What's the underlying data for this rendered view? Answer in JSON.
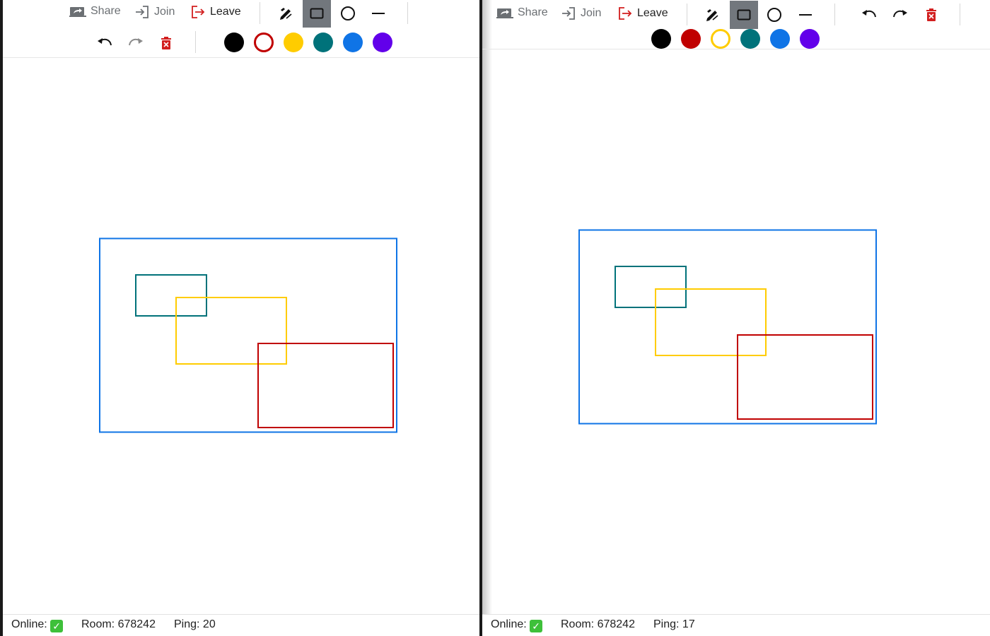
{
  "left": {
    "toolbar": {
      "share_label": "Share",
      "join_label": "Join",
      "leave_label": "Leave",
      "active_tool": "rectangle"
    },
    "palette": [
      {
        "name": "black",
        "color": "#000000",
        "selected": false
      },
      {
        "name": "red",
        "color": "#c00000",
        "selected": true
      },
      {
        "name": "yellow",
        "color": "#ffcc00",
        "selected": false
      },
      {
        "name": "teal",
        "color": "#00727a",
        "selected": false
      },
      {
        "name": "blue",
        "color": "#0f74e6",
        "selected": false
      },
      {
        "name": "purple",
        "color": "#6200ea",
        "selected": false
      }
    ],
    "status": {
      "online_label": "Online:",
      "room_label": "Room: 678242",
      "ping_label": "Ping: 20"
    }
  },
  "right": {
    "toolbar": {
      "share_label": "Share",
      "join_label": "Join",
      "leave_label": "Leave",
      "active_tool": "rectangle"
    },
    "palette": [
      {
        "name": "black",
        "color": "#000000",
        "selected": false
      },
      {
        "name": "red",
        "color": "#c00000",
        "selected": false
      },
      {
        "name": "yellow",
        "color": "#ffcc00",
        "selected": true
      },
      {
        "name": "teal",
        "color": "#00727a",
        "selected": false
      },
      {
        "name": "blue",
        "color": "#0f74e6",
        "selected": false
      },
      {
        "name": "purple",
        "color": "#6200ea",
        "selected": false
      }
    ],
    "status": {
      "online_label": "Online:",
      "room_label": "Room: 678242",
      "ping_label": "Ping: 17"
    }
  },
  "canvas_shapes": [
    {
      "name": "blue-rectangle",
      "color": "#0f74e6"
    },
    {
      "name": "teal-rectangle",
      "color": "#00727a"
    },
    {
      "name": "yellow-rectangle",
      "color": "#ffcc00"
    },
    {
      "name": "red-rectangle",
      "color": "#c00000"
    }
  ],
  "icon_color": "#d21f1f"
}
